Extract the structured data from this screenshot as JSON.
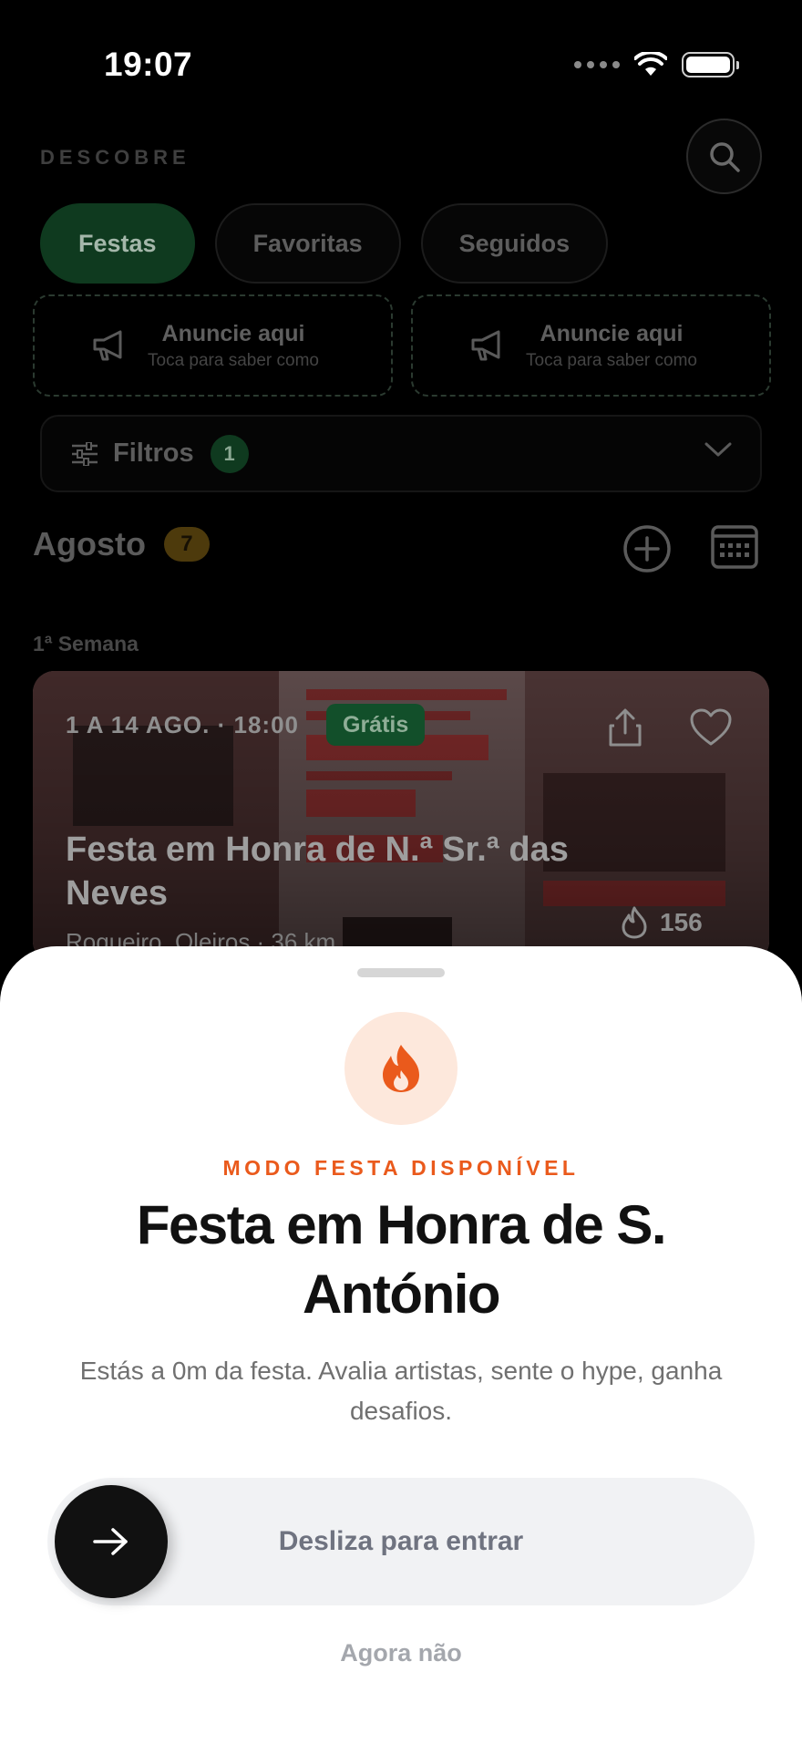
{
  "status_bar": {
    "time": "19:07",
    "icons": [
      "cellular-dots-icon",
      "wifi-icon",
      "battery-icon"
    ]
  },
  "header": {
    "section_label": "DESCOBRE",
    "search_icon": "search-icon"
  },
  "tabs": [
    {
      "label": "Festas",
      "active": true
    },
    {
      "label": "Favoritas",
      "active": false
    },
    {
      "label": "Seguidos",
      "active": false
    }
  ],
  "ads": [
    {
      "title": "Anuncie aqui",
      "subtitle": "Toca para saber como",
      "icon": "megaphone-icon"
    },
    {
      "title": "Anuncie aqui",
      "subtitle": "Toca para saber como",
      "icon": "megaphone-icon"
    }
  ],
  "filters": {
    "label": "Filtros",
    "count": "1",
    "icon": "sliders-icon"
  },
  "month_section": {
    "month": "Agosto",
    "count": "7",
    "actions": [
      "add-icon",
      "calendar-icon"
    ]
  },
  "week_label": "1ª Semana",
  "event_card": {
    "date_time": "1 A 14 AGO. · 18:00",
    "price_badge": "Grátis",
    "title": "Festa em Honra de N.ª Sr.ª das Neves",
    "location": "Roqueiro, Oleiros · 36 km",
    "hype_count": "156"
  },
  "sheet": {
    "mode_label": "MODO FESTA DISPONÍVEL",
    "title": "Festa em Honra de S. António",
    "subtitle": "Estás a 0m da festa. Avalia artistas, sente o hype, ganha desafios.",
    "slider_label": "Desliza para entrar",
    "dismiss_label": "Agora não",
    "icon": "fire-icon"
  },
  "colors": {
    "accent_green": "#0f3a1f",
    "accent_orange": "#ea5a1c",
    "badge_gold": "#4d3a0c",
    "sheet_bg": "#ffffff"
  }
}
